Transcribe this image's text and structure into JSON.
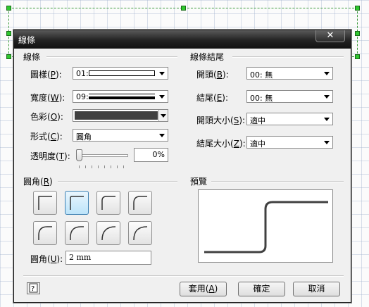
{
  "dialog": {
    "title": "線條",
    "close_glyph": "✕"
  },
  "line_section": {
    "title": "線條",
    "pattern": {
      "label": "圖樣",
      "key": "P",
      "value": "01:"
    },
    "weight": {
      "label": "寬度",
      "key": "W",
      "value": "09:"
    },
    "color": {
      "label": "色彩",
      "key": "O",
      "value_color": "#404040"
    },
    "style": {
      "label": "形式",
      "key": "C",
      "value": "圓角"
    },
    "transparency": {
      "label": "透明度",
      "key": "T",
      "value": "0%",
      "level_percent": 0
    }
  },
  "line_ends": {
    "title": "線條結尾",
    "begin": {
      "label": "開頭",
      "key": "B",
      "value": "00: 無"
    },
    "end": {
      "label": "結尾",
      "key": "E",
      "value": "00: 無"
    },
    "begin_size": {
      "label": "開頭大小",
      "key": "S",
      "value": "適中"
    },
    "end_size": {
      "label": "結尾大小",
      "key": "Z",
      "value": "適中"
    }
  },
  "rounding": {
    "title": "圓角",
    "key": "R",
    "selected_index": 1,
    "size": {
      "label": "圓角",
      "key": "U",
      "value": "2 mm"
    }
  },
  "preview": {
    "title": "預覽"
  },
  "buttons": {
    "apply": {
      "label": "套用",
      "key": "A"
    },
    "ok": {
      "label": "確定"
    },
    "cancel": {
      "label": "取消"
    },
    "help_icon": "help-icon"
  }
}
